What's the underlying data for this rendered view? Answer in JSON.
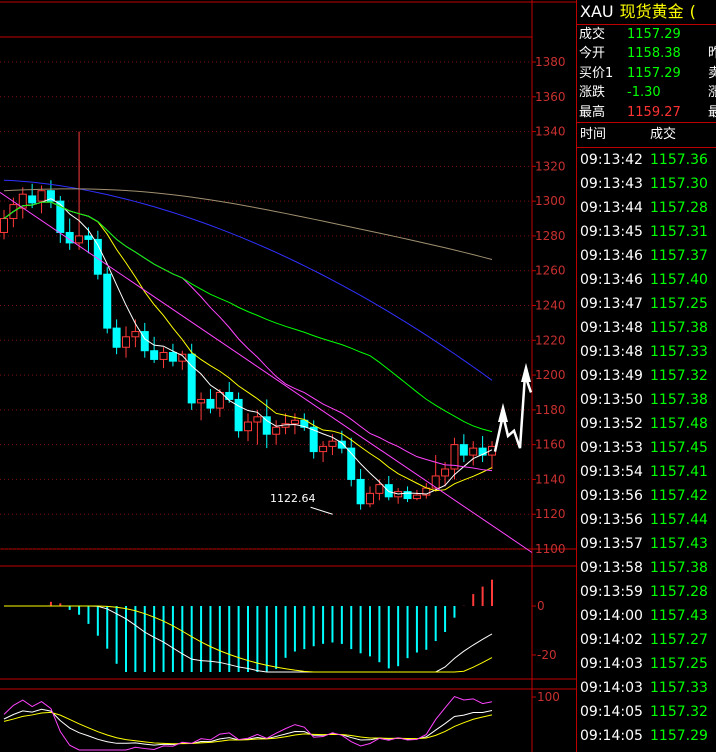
{
  "header": {
    "symbol": "XAU",
    "name": "现货黄金",
    "extra": "("
  },
  "quote": [
    {
      "label": "成交",
      "value": "1157.29",
      "color": "#00ff00",
      "extra": ""
    },
    {
      "label": "今开",
      "value": "1158.38",
      "color": "#00ff00",
      "extra": "昨"
    },
    {
      "label": "买价1",
      "value": "1157.29",
      "color": "#00ff00",
      "extra": "卖"
    },
    {
      "label": "涨跌",
      "value": "-1.30",
      "color": "#00ff00",
      "extra": "涨"
    },
    {
      "label": "最高",
      "value": "1159.27",
      "color": "#ff3333",
      "extra": "最"
    }
  ],
  "ticks_header": {
    "time": "时间",
    "price": "成交"
  },
  "ticks": [
    {
      "time": "09:13:42",
      "price": "1157.36"
    },
    {
      "time": "09:13:43",
      "price": "1157.30"
    },
    {
      "time": "09:13:44",
      "price": "1157.28"
    },
    {
      "time": "09:13:45",
      "price": "1157.31"
    },
    {
      "time": "09:13:46",
      "price": "1157.37"
    },
    {
      "time": "09:13:46",
      "price": "1157.40"
    },
    {
      "time": "09:13:47",
      "price": "1157.25"
    },
    {
      "time": "09:13:48",
      "price": "1157.38"
    },
    {
      "time": "09:13:48",
      "price": "1157.33"
    },
    {
      "time": "09:13:49",
      "price": "1157.32"
    },
    {
      "time": "09:13:50",
      "price": "1157.38"
    },
    {
      "time": "09:13:52",
      "price": "1157.48"
    },
    {
      "time": "09:13:53",
      "price": "1157.45"
    },
    {
      "time": "09:13:54",
      "price": "1157.41"
    },
    {
      "time": "09:13:56",
      "price": "1157.42"
    },
    {
      "time": "09:13:56",
      "price": "1157.44"
    },
    {
      "time": "09:13:57",
      "price": "1157.43"
    },
    {
      "time": "09:13:58",
      "price": "1157.38"
    },
    {
      "time": "09:13:59",
      "price": "1157.28"
    },
    {
      "time": "09:14:00",
      "price": "1157.43"
    },
    {
      "time": "09:14:02",
      "price": "1157.27"
    },
    {
      "time": "09:14:03",
      "price": "1157.25"
    },
    {
      "time": "09:14:03",
      "price": "1157.33"
    },
    {
      "time": "09:14:05",
      "price": "1157.32"
    },
    {
      "time": "09:14:05",
      "price": "1157.29"
    }
  ],
  "chart_data": {
    "type": "candlestick",
    "price_axis": {
      "min": 1100,
      "max": 1390,
      "ticks": [
        "1380",
        "1360",
        "1340",
        "1320",
        "1300",
        "1280",
        "1260",
        "1240",
        "1220",
        "1200",
        "1180",
        "1160",
        "1140",
        "1120",
        "1100"
      ]
    },
    "low_annotation": "1122.64",
    "candles": [
      {
        "o": 1282,
        "h": 1295,
        "l": 1278,
        "c": 1290
      },
      {
        "o": 1290,
        "h": 1302,
        "l": 1285,
        "c": 1298
      },
      {
        "o": 1296,
        "h": 1308,
        "l": 1290,
        "c": 1304
      },
      {
        "o": 1303,
        "h": 1310,
        "l": 1296,
        "c": 1299
      },
      {
        "o": 1300,
        "h": 1309,
        "l": 1293,
        "c": 1306
      },
      {
        "o": 1306,
        "h": 1312,
        "l": 1296,
        "c": 1300
      },
      {
        "o": 1300,
        "h": 1303,
        "l": 1276,
        "c": 1282
      },
      {
        "o": 1282,
        "h": 1290,
        "l": 1272,
        "c": 1276
      },
      {
        "o": 1276,
        "h": 1340,
        "l": 1272,
        "c": 1280
      },
      {
        "o": 1280,
        "h": 1285,
        "l": 1270,
        "c": 1278
      },
      {
        "o": 1278,
        "h": 1283,
        "l": 1255,
        "c": 1258
      },
      {
        "o": 1258,
        "h": 1262,
        "l": 1224,
        "c": 1227
      },
      {
        "o": 1227,
        "h": 1232,
        "l": 1212,
        "c": 1216
      },
      {
        "o": 1216,
        "h": 1228,
        "l": 1210,
        "c": 1222
      },
      {
        "o": 1222,
        "h": 1232,
        "l": 1216,
        "c": 1225
      },
      {
        "o": 1225,
        "h": 1230,
        "l": 1210,
        "c": 1214
      },
      {
        "o": 1214,
        "h": 1222,
        "l": 1207,
        "c": 1209
      },
      {
        "o": 1209,
        "h": 1216,
        "l": 1204,
        "c": 1213
      },
      {
        "o": 1213,
        "h": 1218,
        "l": 1205,
        "c": 1208
      },
      {
        "o": 1208,
        "h": 1214,
        "l": 1203,
        "c": 1212
      },
      {
        "o": 1212,
        "h": 1218,
        "l": 1180,
        "c": 1184
      },
      {
        "o": 1184,
        "h": 1190,
        "l": 1174,
        "c": 1186
      },
      {
        "o": 1186,
        "h": 1192,
        "l": 1178,
        "c": 1181
      },
      {
        "o": 1181,
        "h": 1192,
        "l": 1176,
        "c": 1190
      },
      {
        "o": 1190,
        "h": 1196,
        "l": 1184,
        "c": 1186
      },
      {
        "o": 1186,
        "h": 1190,
        "l": 1164,
        "c": 1168
      },
      {
        "o": 1168,
        "h": 1178,
        "l": 1162,
        "c": 1173
      },
      {
        "o": 1173,
        "h": 1180,
        "l": 1160,
        "c": 1176
      },
      {
        "o": 1176,
        "h": 1186,
        "l": 1158,
        "c": 1166
      },
      {
        "o": 1166,
        "h": 1174,
        "l": 1160,
        "c": 1170
      },
      {
        "o": 1170,
        "h": 1178,
        "l": 1166,
        "c": 1172
      },
      {
        "o": 1172,
        "h": 1178,
        "l": 1166,
        "c": 1174
      },
      {
        "o": 1174,
        "h": 1178,
        "l": 1168,
        "c": 1170
      },
      {
        "o": 1170,
        "h": 1174,
        "l": 1152,
        "c": 1156
      },
      {
        "o": 1156,
        "h": 1162,
        "l": 1150,
        "c": 1159
      },
      {
        "o": 1159,
        "h": 1166,
        "l": 1154,
        "c": 1162
      },
      {
        "o": 1162,
        "h": 1168,
        "l": 1155,
        "c": 1158
      },
      {
        "o": 1158,
        "h": 1164,
        "l": 1136,
        "c": 1140
      },
      {
        "o": 1140,
        "h": 1146,
        "l": 1122.64,
        "c": 1126
      },
      {
        "o": 1126,
        "h": 1136,
        "l": 1124,
        "c": 1132
      },
      {
        "o": 1132,
        "h": 1140,
        "l": 1128,
        "c": 1137
      },
      {
        "o": 1137,
        "h": 1142,
        "l": 1128,
        "c": 1130
      },
      {
        "o": 1130,
        "h": 1135,
        "l": 1126,
        "c": 1133
      },
      {
        "o": 1133,
        "h": 1136,
        "l": 1127,
        "c": 1129
      },
      {
        "o": 1129,
        "h": 1134,
        "l": 1128,
        "c": 1131
      },
      {
        "o": 1131,
        "h": 1138,
        "l": 1129,
        "c": 1135
      },
      {
        "o": 1135,
        "h": 1154,
        "l": 1133,
        "c": 1142
      },
      {
        "o": 1142,
        "h": 1150,
        "l": 1136,
        "c": 1146
      },
      {
        "o": 1146,
        "h": 1164,
        "l": 1140,
        "c": 1160
      },
      {
        "o": 1160,
        "h": 1166,
        "l": 1150,
        "c": 1154
      },
      {
        "o": 1154,
        "h": 1162,
        "l": 1148,
        "c": 1158
      },
      {
        "o": 1158,
        "h": 1165,
        "l": 1150,
        "c": 1154
      },
      {
        "o": 1154,
        "h": 1162,
        "l": 1146,
        "c": 1159
      }
    ],
    "forecast_path": [
      [
        1159,
        1156
      ],
      [
        1158,
        1177
      ],
      [
        1161,
        1168
      ],
      [
        1162,
        1177
      ],
      [
        1159,
        1162
      ],
      [
        1163,
        1197
      ],
      [
        1166,
        1186
      ],
      [
        1167,
        1204
      ]
    ],
    "macd": {
      "ticks": [
        "0",
        "-20"
      ],
      "range": [
        -25,
        25
      ]
    },
    "kdj": {
      "ticks": [
        "100"
      ],
      "range": [
        0,
        110
      ]
    }
  }
}
